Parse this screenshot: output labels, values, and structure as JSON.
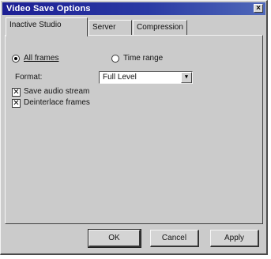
{
  "window": {
    "title": "Video Save Options",
    "close_glyph": "×"
  },
  "tabs": [
    {
      "label": "Inactive Studio",
      "active": true
    },
    {
      "label": "Server",
      "active": false
    },
    {
      "label": "Compression",
      "active": false
    }
  ],
  "range": {
    "option_all": "All frames",
    "option_range": "Time range",
    "selected": "All frames"
  },
  "format": {
    "label": "Format:",
    "value": "Full Level",
    "arrow_glyph": "▼"
  },
  "checkboxes": [
    {
      "label": "Save audio stream",
      "checked": true
    },
    {
      "label": "Deinterlace frames",
      "checked": true
    }
  ],
  "buttons": {
    "ok": "OK",
    "cancel": "Cancel",
    "apply": "Apply"
  },
  "colors": {
    "title_bar": "#1d1f94",
    "dialog_face": "#cbcbcb"
  }
}
